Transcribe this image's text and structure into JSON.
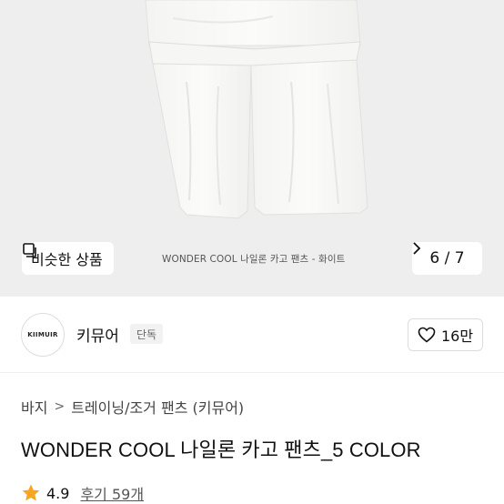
{
  "gallery": {
    "similar_label": "비슷한 상품",
    "caption": "WONDER COOL 나일론 카고 팬츠 - 화이트",
    "pager": "6 / 7"
  },
  "brand": {
    "logo_text": "KIIMUIR",
    "name": "키뮤어",
    "tag": "단독",
    "likes": "16만"
  },
  "breadcrumb": {
    "category": "바지",
    "subcategory": "트레이닝/조거 팬츠 (키뮤어)"
  },
  "product": {
    "title": "WONDER COOL 나일론 카고 팬츠_5 COLOR"
  },
  "rating": {
    "score": "4.9",
    "reviews": "후기 59개"
  },
  "colors": {
    "accent_star": "#f5a623",
    "hero_bg": "#eeeeee"
  }
}
